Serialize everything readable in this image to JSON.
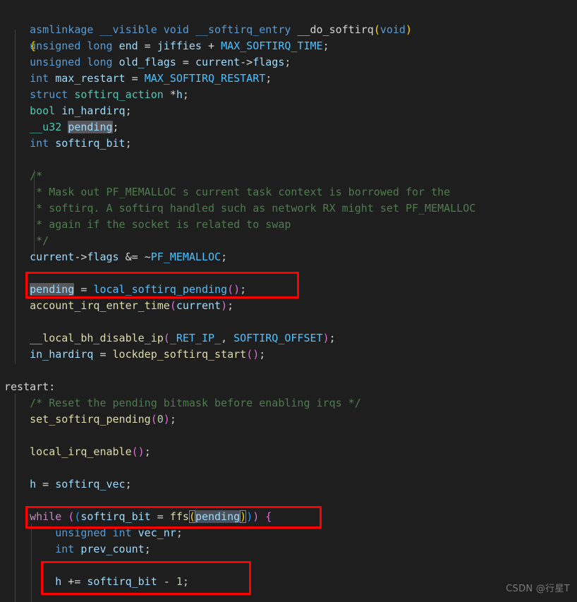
{
  "editor": {
    "language": "c",
    "theme": "dark-plus",
    "background_color": "#1e1e1e",
    "foreground_color": "#d4d4d4",
    "annotation_color": "#fe0000",
    "highlight_color": "#57575c",
    "lines": [
      "asmlinkage __visible void __softirq_entry __do_softirq(void)",
      "{",
      "    unsigned long end = jiffies + MAX_SOFTIRQ_TIME;",
      "    unsigned long old_flags = current->flags;",
      "    int max_restart = MAX_SOFTIRQ_RESTART;",
      "    struct softirq_action *h;",
      "    bool in_hardirq;",
      "    __u32 pending;",
      "    int softirq_bit;",
      "",
      "    /*",
      "     * Mask out PF_MEMALLOC s current task context is borrowed for the",
      "     * softirq. A softirq handled such as network RX might set PF_MEMALLOC",
      "     * again if the socket is related to swap",
      "     */",
      "    current->flags &= ~PF_MEMALLOC;",
      "",
      "    pending = local_softirq_pending();",
      "    account_irq_enter_time(current);",
      "",
      "    __local_bh_disable_ip(_RET_IP_, SOFTIRQ_OFFSET);",
      "    in_hardirq = lockdep_softirq_start();",
      "",
      "restart:",
      "    /* Reset the pending bitmask before enabling irqs */",
      "    set_softirq_pending(0);",
      "",
      "    local_irq_enable();",
      "",
      "    h = softirq_vec;",
      "",
      "    while ((softirq_bit = ffs(pending))) {",
      "        unsigned int vec_nr;",
      "        int prev_count;",
      "",
      "        h += softirq_bit - 1;"
    ]
  },
  "tokens": {
    "l1": {
      "asmlinkage": "asmlinkage",
      "visible": "__visible",
      "void_kw": "void",
      "softirq_entry": "__softirq_entry",
      "fname": "__do_softirq",
      "open_paren": "(",
      "void_arg": "void",
      "close_paren": ")"
    },
    "l2": {
      "brace": "{"
    },
    "l3": {
      "unsigned": "unsigned",
      "long": "long",
      "end": "end",
      "eq": " = ",
      "jiffies": "jiffies",
      "plus": " + ",
      "macro": "MAX_SOFTIRQ_TIME",
      "semi": ";"
    },
    "l4": {
      "unsigned": "unsigned",
      "long": "long",
      "old_flags": "old_flags",
      "eq": " = ",
      "current": "current",
      "arrow": "->",
      "flags": "flags",
      "semi": ";"
    },
    "l5": {
      "int": "int",
      "max_restart": "max_restart",
      "eq": " = ",
      "macro": "MAX_SOFTIRQ_RESTART",
      "semi": ";"
    },
    "l6": {
      "struct": "struct",
      "type": "softirq_action",
      "star": "*",
      "h": "h",
      "semi": ";"
    },
    "l7": {
      "bool": "bool",
      "in_hardirq": "in_hardirq",
      "semi": ";"
    },
    "l8": {
      "u32": "__u32",
      "pending": "pending",
      "semi": ";"
    },
    "l9": {
      "int": "int",
      "softirq_bit": "softirq_bit",
      "semi": ";"
    },
    "c1": "/*",
    "c2": " * Mask out PF_MEMALLOC s current task context is borrowed for the",
    "c3": " * softirq. A softirq handled such as network RX might set PF_MEMALLOC",
    "c4": " * again if the socket is related to swap",
    "c5": " */",
    "l16": {
      "current": "current",
      "arrow": "->",
      "flags": "flags",
      "andeq": " &= ",
      "tilde": "~",
      "macro": "PF_MEMALLOC",
      "semi": ";"
    },
    "l18": {
      "pending": "pending",
      "eq": " = ",
      "fn": "local_softirq_pending",
      "open": "(",
      "close": ")",
      "semi": ";"
    },
    "l19": {
      "fn": "account_irq_enter_time",
      "open": "(",
      "current": "current",
      "close": ")",
      "semi": ";"
    },
    "l21": {
      "fn": "__local_bh_disable_ip",
      "open": "(",
      "arg1": "_RET_IP_",
      "comma": ", ",
      "arg2": "SOFTIRQ_OFFSET",
      "close": ")",
      "semi": ";"
    },
    "l22": {
      "in_hardirq": "in_hardirq",
      "eq": " = ",
      "fn": "lockdep_softirq_start",
      "open": "(",
      "close": ")",
      "semi": ";"
    },
    "l24": {
      "label": "restart:"
    },
    "c6": "/* Reset the pending bitmask before enabling irqs */",
    "l26": {
      "fn": "set_softirq_pending",
      "open": "(",
      "zero": "0",
      "close": ")",
      "semi": ";"
    },
    "l28": {
      "fn": "local_irq_enable",
      "open": "(",
      "close": ")",
      "semi": ";"
    },
    "l30": {
      "h": "h",
      "eq": " = ",
      "softirq_vec": "softirq_vec",
      "semi": ";"
    },
    "l32": {
      "while": "while",
      "sp": " ",
      "p1": "(",
      "p2": "(",
      "softirq_bit": "softirq_bit",
      "eq": " = ",
      "ffs": "ffs",
      "p3": "(",
      "pending": "pending",
      "p4": ")",
      "p5": ")",
      "p6": ")",
      "brace": " {"
    },
    "l33": {
      "unsigned": "unsigned",
      "int": "int",
      "vec_nr": "vec_nr",
      "semi": ";"
    },
    "l34": {
      "int": "int",
      "prev_count": "prev_count",
      "semi": ";"
    },
    "l36": {
      "h": "h",
      "pluseq": " += ",
      "softirq_bit": "softirq_bit",
      "minus": " - ",
      "one": "1",
      "semi": ";"
    }
  },
  "annotations": [
    {
      "name": "highlight-box-pending-assignment",
      "label": "pending = local_softirq_pending();"
    },
    {
      "name": "highlight-box-while-loop",
      "label": "while ((softirq_bit = ffs(pending))) {"
    },
    {
      "name": "highlight-box-h-increment",
      "label": "h += softirq_bit - 1;"
    }
  ],
  "watermark": {
    "text": "CSDN @行星T"
  }
}
